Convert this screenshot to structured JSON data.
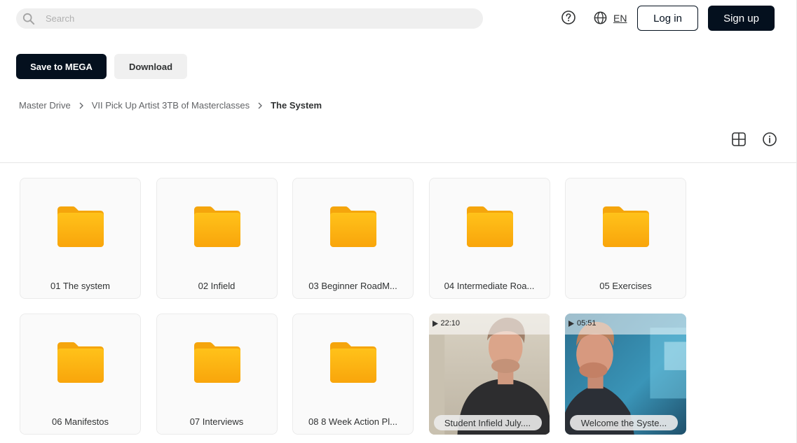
{
  "search": {
    "placeholder": "Search"
  },
  "header": {
    "language": "EN",
    "login_label": "Log in",
    "signup_label": "Sign up"
  },
  "actions": {
    "save_label": "Save to MEGA",
    "download_label": "Download"
  },
  "breadcrumb": {
    "items": [
      "Master Drive",
      "VII Pick Up Artist 3TB of Masterclasses"
    ],
    "current": "The System"
  },
  "items": [
    {
      "type": "folder",
      "name": "01 The system"
    },
    {
      "type": "folder",
      "name": "02 Infield"
    },
    {
      "type": "folder",
      "name": "03 Beginner RoadM..."
    },
    {
      "type": "folder",
      "name": "04 Intermediate Roa..."
    },
    {
      "type": "folder",
      "name": "05 Exercises"
    },
    {
      "type": "folder",
      "name": "06 Manifestos"
    },
    {
      "type": "folder",
      "name": "07 Interviews"
    },
    {
      "type": "folder",
      "name": "08 8 Week Action Pl..."
    },
    {
      "type": "video",
      "name": "Student Infield July....",
      "duration": "22:10"
    },
    {
      "type": "video",
      "name": "Welcome the Syste...",
      "duration": "05:51"
    }
  ],
  "colors": {
    "primary": "#04101e",
    "folder_top": "#ffc21a",
    "folder_bottom": "#f9a50b"
  },
  "icons": {
    "search": "search-icon",
    "help": "help-icon",
    "language": "globe-icon",
    "view_toggle": "grid-view-icon",
    "info": "info-icon"
  }
}
